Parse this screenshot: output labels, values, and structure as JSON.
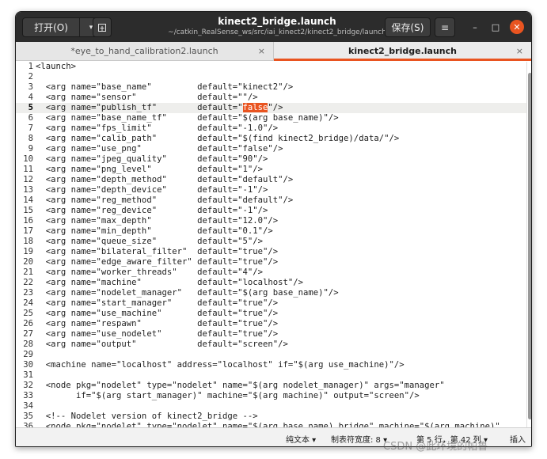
{
  "header": {
    "open_label": "打开(O)",
    "open_arrow": "▾",
    "title": "kinect2_bridge.launch",
    "subtitle": "~/catkin_RealSense_ws/src/iai_kinect2/kinect2_bridge/launch",
    "save_label": "保存(S)",
    "menu_icon": "≡",
    "minimize_icon": "–",
    "maximize_icon": "□",
    "close_icon": "✕"
  },
  "tabs": [
    {
      "label": "*eye_to_hand_calibration2.launch",
      "close": "×",
      "active": false
    },
    {
      "label": "kinect2_bridge.launch",
      "close": "×",
      "active": true
    }
  ],
  "editor": {
    "current_line": 5,
    "highlight": "false",
    "lines": [
      {
        "n": "1",
        "text": "<launch>"
      },
      {
        "n": "2",
        "text": ""
      },
      {
        "n": "3",
        "text": "  <arg name=\"base_name\"         default=\"kinect2\"/>"
      },
      {
        "n": "4",
        "text": "  <arg name=\"sensor\"            default=\"\"/>"
      },
      {
        "n": "5",
        "pre": "  <arg name=\"publish_tf\"        default=\"",
        "mid": "false",
        "post": "\"/>"
      },
      {
        "n": "6",
        "text": "  <arg name=\"base_name_tf\"      default=\"$(arg base_name)\"/>"
      },
      {
        "n": "7",
        "text": "  <arg name=\"fps_limit\"         default=\"-1.0\"/>"
      },
      {
        "n": "8",
        "text": "  <arg name=\"calib_path\"        default=\"$(find kinect2_bridge)/data/\"/>"
      },
      {
        "n": "9",
        "text": "  <arg name=\"use_png\"           default=\"false\"/>"
      },
      {
        "n": "10",
        "text": "  <arg name=\"jpeg_quality\"      default=\"90\"/>"
      },
      {
        "n": "11",
        "text": "  <arg name=\"png_level\"         default=\"1\"/>"
      },
      {
        "n": "12",
        "text": "  <arg name=\"depth_method\"      default=\"default\"/>"
      },
      {
        "n": "13",
        "text": "  <arg name=\"depth_device\"      default=\"-1\"/>"
      },
      {
        "n": "14",
        "text": "  <arg name=\"reg_method\"        default=\"default\"/>"
      },
      {
        "n": "15",
        "text": "  <arg name=\"reg_device\"        default=\"-1\"/>"
      },
      {
        "n": "16",
        "text": "  <arg name=\"max_depth\"         default=\"12.0\"/>"
      },
      {
        "n": "17",
        "text": "  <arg name=\"min_depth\"         default=\"0.1\"/>"
      },
      {
        "n": "18",
        "text": "  <arg name=\"queue_size\"        default=\"5\"/>"
      },
      {
        "n": "19",
        "text": "  <arg name=\"bilateral_filter\"  default=\"true\"/>"
      },
      {
        "n": "20",
        "text": "  <arg name=\"edge_aware_filter\" default=\"true\"/>"
      },
      {
        "n": "21",
        "text": "  <arg name=\"worker_threads\"    default=\"4\"/>"
      },
      {
        "n": "22",
        "text": "  <arg name=\"machine\"           default=\"localhost\"/>"
      },
      {
        "n": "23",
        "text": "  <arg name=\"nodelet_manager\"   default=\"$(arg base_name)\"/>"
      },
      {
        "n": "24",
        "text": "  <arg name=\"start_manager\"     default=\"true\"/>"
      },
      {
        "n": "25",
        "text": "  <arg name=\"use_machine\"       default=\"true\"/>"
      },
      {
        "n": "26",
        "text": "  <arg name=\"respawn\"           default=\"true\"/>"
      },
      {
        "n": "27",
        "text": "  <arg name=\"use_nodelet\"       default=\"true\"/>"
      },
      {
        "n": "28",
        "text": "  <arg name=\"output\"            default=\"screen\"/>"
      },
      {
        "n": "29",
        "text": ""
      },
      {
        "n": "30",
        "text": "  <machine name=\"localhost\" address=\"localhost\" if=\"$(arg use_machine)\"/>"
      },
      {
        "n": "31",
        "text": ""
      },
      {
        "n": "32",
        "text": "  <node pkg=\"nodelet\" type=\"nodelet\" name=\"$(arg nodelet_manager)\" args=\"manager\""
      },
      {
        "n": "33",
        "text": "        if=\"$(arg start_manager)\" machine=\"$(arg machine)\" output=\"screen\"/>"
      },
      {
        "n": "34",
        "text": ""
      },
      {
        "n": "35",
        "text": "  <!-- Nodelet version of kinect2_bridge -->"
      },
      {
        "n": "36",
        "text": "  <node pkg=\"nodelet\" type=\"nodelet\" name=\"$(arg base_name)_bridge\" machine=\"$(arg machine)\""
      }
    ]
  },
  "status": {
    "language": "纯文本 ▾",
    "tab_width": "制表符宽度: 8 ▾",
    "position": "第 5 行，第 42 列",
    "position_arrow": "▾",
    "mode": "插入"
  },
  "watermark": "CSDN @此环境的帕鲁",
  "colors": {
    "accent": "#e95420",
    "headerbar": "#2c2c2c"
  }
}
